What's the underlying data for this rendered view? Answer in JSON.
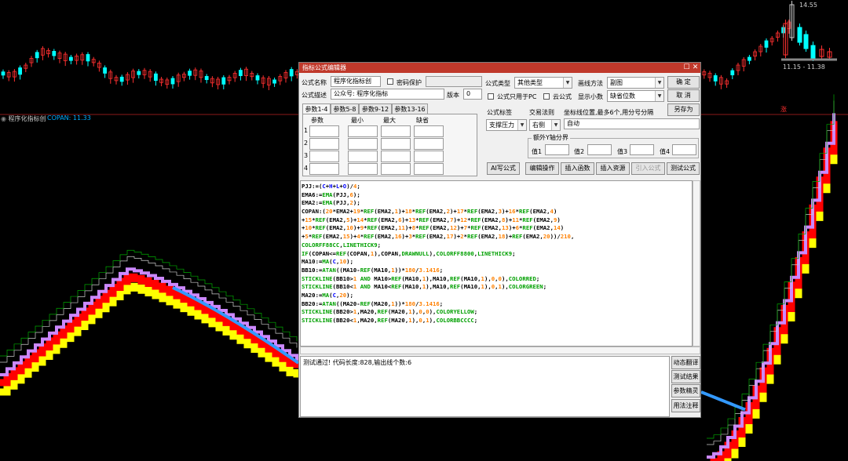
{
  "chart": {
    "indicator_name": "程序化指标创",
    "indicator_value": "COPAN: 11.33",
    "price_high": "14.55",
    "price_range": "11.15 - 11.38",
    "rise_badge": "涨",
    "colors": {
      "red": "#ff0000",
      "yellow": "#ffff00",
      "violet": "#cc88ff",
      "blue": "#3399ff",
      "green": "#00aa00",
      "white": "#cccccc",
      "cyan": "#00ffff"
    }
  },
  "dialog": {
    "title": "指标公式编辑器",
    "formula_name_label": "公式名称",
    "formula_name_value": "程序化指标创",
    "password_label": "密码保护",
    "formula_desc_label": "公式描述",
    "formula_desc_value": "公众号: 程序化指标",
    "version_label": "版本",
    "version_value": "0",
    "type_label": "公式类型",
    "type_value": "其他类型",
    "draw_label": "画线方法",
    "draw_value": "副图",
    "pc_label": "公式只用于PC",
    "cloud_label": "云公式",
    "decimals_label": "显示小数",
    "decimals_value": "缺省位数",
    "confirm": "确  定",
    "cancel": "取  消",
    "save_as": "另存为",
    "tabs": [
      "参数1-4",
      "参数5-8",
      "参数9-12",
      "参数13-16"
    ],
    "param_headers": [
      "参数",
      "最小",
      "最大",
      "缺省"
    ],
    "param_rows": [
      "1",
      "2",
      "3",
      "4"
    ],
    "tag_label": "公式标签",
    "rule_label": "交易法则",
    "coord_label": "坐标线位置,最多6个,用分号分隔",
    "tag_value": "支撑压力",
    "rule_value": "右侧",
    "coord_value": "自动",
    "extra_axis_label": "额外Y轴分界",
    "values": [
      "值1",
      "值2",
      "值3",
      "值4"
    ],
    "ai_btn": "AI写公式",
    "edit_btn": "编辑操作",
    "insert_fn_btn": "插入函数",
    "insert_res_btn": "插入资源",
    "import_btn": "引入公式",
    "test_btn": "测试公式",
    "status": "测试通过! 代码长度:828,输出线个数:6",
    "side_btns": [
      "动态翻译",
      "测试结果",
      "参数精灵",
      "用法注释"
    ]
  },
  "code_lines": [
    [
      [
        "d",
        "PJJ:=("
      ],
      [
        "k",
        "C"
      ],
      [
        "d",
        "+"
      ],
      [
        "k",
        "H"
      ],
      [
        "d",
        "+"
      ],
      [
        "k",
        "L"
      ],
      [
        "d",
        "+"
      ],
      [
        "k",
        "O"
      ],
      [
        "d",
        ")/"
      ],
      [
        "n",
        "4"
      ],
      [
        "d",
        ";"
      ]
    ],
    [
      [
        "d",
        "EMA6:="
      ],
      [
        "f",
        "EMA"
      ],
      [
        "d",
        "(PJJ,"
      ],
      [
        "n",
        "6"
      ],
      [
        "d",
        ");"
      ]
    ],
    [
      [
        "d",
        "EMA2:="
      ],
      [
        "f",
        "EMA"
      ],
      [
        "d",
        "(PJJ,"
      ],
      [
        "n",
        "2"
      ],
      [
        "d",
        ");"
      ]
    ],
    [
      [
        "d",
        "COPAN:("
      ],
      [
        "n",
        "20"
      ],
      [
        "d",
        "*EMA2+"
      ],
      [
        "n",
        "19"
      ],
      [
        "d",
        "*"
      ],
      [
        "f",
        "REF"
      ],
      [
        "d",
        "(EMA2,"
      ],
      [
        "n",
        "1"
      ],
      [
        "d",
        ")+"
      ],
      [
        "n",
        "18"
      ],
      [
        "d",
        "*"
      ],
      [
        "f",
        "REF"
      ],
      [
        "d",
        "(EMA2,"
      ],
      [
        "n",
        "2"
      ],
      [
        "d",
        ")+"
      ],
      [
        "n",
        "17"
      ],
      [
        "d",
        "*"
      ],
      [
        "f",
        "REF"
      ],
      [
        "d",
        "(EMA2,"
      ],
      [
        "n",
        "3"
      ],
      [
        "d",
        ")+"
      ],
      [
        "n",
        "16"
      ],
      [
        "d",
        "*"
      ],
      [
        "f",
        "REF"
      ],
      [
        "d",
        "(EMA2,"
      ],
      [
        "n",
        "4"
      ],
      [
        "d",
        ")"
      ]
    ],
    [
      [
        "d",
        "+"
      ],
      [
        "n",
        "15"
      ],
      [
        "d",
        "*"
      ],
      [
        "f",
        "REF"
      ],
      [
        "d",
        "(EMA2,"
      ],
      [
        "n",
        "5"
      ],
      [
        "d",
        ")+"
      ],
      [
        "n",
        "14"
      ],
      [
        "d",
        "*"
      ],
      [
        "f",
        "REF"
      ],
      [
        "d",
        "(EMA2,"
      ],
      [
        "n",
        "6"
      ],
      [
        "d",
        ")+"
      ],
      [
        "n",
        "13"
      ],
      [
        "d",
        "*"
      ],
      [
        "f",
        "REF"
      ],
      [
        "d",
        "(EMA2,"
      ],
      [
        "n",
        "7"
      ],
      [
        "d",
        ")+"
      ],
      [
        "n",
        "12"
      ],
      [
        "d",
        "*"
      ],
      [
        "f",
        "REF"
      ],
      [
        "d",
        "(EMA2,"
      ],
      [
        "n",
        "8"
      ],
      [
        "d",
        ")+"
      ],
      [
        "n",
        "11"
      ],
      [
        "d",
        "*"
      ],
      [
        "f",
        "REF"
      ],
      [
        "d",
        "(EMA2,"
      ],
      [
        "n",
        "9"
      ],
      [
        "d",
        ")"
      ]
    ],
    [
      [
        "d",
        "+"
      ],
      [
        "n",
        "10"
      ],
      [
        "d",
        "*"
      ],
      [
        "f",
        "REF"
      ],
      [
        "d",
        "(EMA2,"
      ],
      [
        "n",
        "10"
      ],
      [
        "d",
        ")+"
      ],
      [
        "n",
        "9"
      ],
      [
        "d",
        "*"
      ],
      [
        "f",
        "REF"
      ],
      [
        "d",
        "(EMA2,"
      ],
      [
        "n",
        "11"
      ],
      [
        "d",
        ")+"
      ],
      [
        "n",
        "8"
      ],
      [
        "d",
        "*"
      ],
      [
        "f",
        "REF"
      ],
      [
        "d",
        "(EMA2,"
      ],
      [
        "n",
        "12"
      ],
      [
        "d",
        ")+"
      ],
      [
        "n",
        "7"
      ],
      [
        "d",
        "*"
      ],
      [
        "f",
        "REF"
      ],
      [
        "d",
        "(EMA2,"
      ],
      [
        "n",
        "13"
      ],
      [
        "d",
        ")+"
      ],
      [
        "n",
        "6"
      ],
      [
        "d",
        "*"
      ],
      [
        "f",
        "REF"
      ],
      [
        "d",
        "(EMA2,"
      ],
      [
        "n",
        "14"
      ],
      [
        "d",
        ")"
      ]
    ],
    [
      [
        "d",
        "+"
      ],
      [
        "n",
        "5"
      ],
      [
        "d",
        "*"
      ],
      [
        "f",
        "REF"
      ],
      [
        "d",
        "(EMA2,"
      ],
      [
        "n",
        "15"
      ],
      [
        "d",
        ")+"
      ],
      [
        "n",
        "4"
      ],
      [
        "d",
        "*"
      ],
      [
        "f",
        "REF"
      ],
      [
        "d",
        "(EMA2,"
      ],
      [
        "n",
        "16"
      ],
      [
        "d",
        ")+"
      ],
      [
        "n",
        "3"
      ],
      [
        "d",
        "*"
      ],
      [
        "f",
        "REF"
      ],
      [
        "d",
        "(EMA2,"
      ],
      [
        "n",
        "17"
      ],
      [
        "d",
        ")+"
      ],
      [
        "n",
        "2"
      ],
      [
        "d",
        "*"
      ],
      [
        "f",
        "REF"
      ],
      [
        "d",
        "(EMA2,"
      ],
      [
        "n",
        "18"
      ],
      [
        "d",
        ")+"
      ],
      [
        "f",
        "REF"
      ],
      [
        "d",
        "(EMA2,"
      ],
      [
        "n",
        "20"
      ],
      [
        "d",
        "))/"
      ],
      [
        "n",
        "210"
      ],
      [
        "d",
        ","
      ]
    ],
    [
      [
        "f",
        "COLORFF88CC"
      ],
      [
        "d",
        ","
      ],
      [
        "f",
        "LINETHICK9"
      ],
      [
        "d",
        ";"
      ]
    ],
    [
      [
        "f",
        "IF"
      ],
      [
        "d",
        "(COPAN<="
      ],
      [
        "f",
        "REF"
      ],
      [
        "d",
        "(COPAN,"
      ],
      [
        "n",
        "1"
      ],
      [
        "d",
        "),COPAN,"
      ],
      [
        "f",
        "DRAWNULL"
      ],
      [
        "d",
        "),"
      ],
      [
        "f",
        "COLORFF8800"
      ],
      [
        "d",
        ","
      ],
      [
        "f",
        "LINETHICK9"
      ],
      [
        "d",
        ";"
      ]
    ],
    [
      [
        "d",
        "MA10:="
      ],
      [
        "f",
        "MA"
      ],
      [
        "d",
        "("
      ],
      [
        "k",
        "C"
      ],
      [
        "d",
        ","
      ],
      [
        "n",
        "10"
      ],
      [
        "d",
        ");"
      ]
    ],
    [
      [
        "d",
        "BB10:="
      ],
      [
        "f",
        "ATAN"
      ],
      [
        "d",
        "((MA10-"
      ],
      [
        "f",
        "REF"
      ],
      [
        "d",
        "(MA10,"
      ],
      [
        "n",
        "1"
      ],
      [
        "d",
        "))*"
      ],
      [
        "n",
        "180"
      ],
      [
        "d",
        "/"
      ],
      [
        "n",
        "3.1416"
      ],
      [
        "d",
        ";"
      ]
    ],
    [
      [
        "f",
        "STICKLINE"
      ],
      [
        "d",
        "(BB10>"
      ],
      [
        "n",
        "1"
      ],
      [
        "d",
        " "
      ],
      [
        "f",
        "AND"
      ],
      [
        "d",
        " MA10>"
      ],
      [
        "f",
        "REF"
      ],
      [
        "d",
        "(MA10,"
      ],
      [
        "n",
        "1"
      ],
      [
        "d",
        "),MA10,"
      ],
      [
        "f",
        "REF"
      ],
      [
        "d",
        "(MA10,"
      ],
      [
        "n",
        "1"
      ],
      [
        "d",
        "),"
      ],
      [
        "n",
        "0"
      ],
      [
        "d",
        ","
      ],
      [
        "n",
        "0"
      ],
      [
        "d",
        "),"
      ],
      [
        "f",
        "COLORRED"
      ],
      [
        "d",
        ";"
      ]
    ],
    [
      [
        "f",
        "STICKLINE"
      ],
      [
        "d",
        "(BB10<"
      ],
      [
        "n",
        "1"
      ],
      [
        "d",
        " "
      ],
      [
        "f",
        "AND"
      ],
      [
        "d",
        " MA10<"
      ],
      [
        "f",
        "REF"
      ],
      [
        "d",
        "(MA10,"
      ],
      [
        "n",
        "1"
      ],
      [
        "d",
        "),MA10,"
      ],
      [
        "f",
        "REF"
      ],
      [
        "d",
        "(MA10,"
      ],
      [
        "n",
        "1"
      ],
      [
        "d",
        "),"
      ],
      [
        "n",
        "0"
      ],
      [
        "d",
        ","
      ],
      [
        "n",
        "1"
      ],
      [
        "d",
        "),"
      ],
      [
        "f",
        "COLORGREEN"
      ],
      [
        "d",
        ";"
      ]
    ],
    [
      [
        "d",
        "MA20:="
      ],
      [
        "f",
        "MA"
      ],
      [
        "d",
        "("
      ],
      [
        "k",
        "C"
      ],
      [
        "d",
        ","
      ],
      [
        "n",
        "20"
      ],
      [
        "d",
        ");"
      ]
    ],
    [
      [
        "d",
        "BB20:="
      ],
      [
        "f",
        "ATAN"
      ],
      [
        "d",
        "((MA20-"
      ],
      [
        "f",
        "REF"
      ],
      [
        "d",
        "(MA20,"
      ],
      [
        "n",
        "1"
      ],
      [
        "d",
        "))*"
      ],
      [
        "n",
        "180"
      ],
      [
        "d",
        "/"
      ],
      [
        "n",
        "3.1416"
      ],
      [
        "d",
        ";"
      ]
    ],
    [
      [
        "f",
        "STICKLINE"
      ],
      [
        "d",
        "(BB20>"
      ],
      [
        "n",
        "1"
      ],
      [
        "d",
        ",MA20,"
      ],
      [
        "f",
        "REF"
      ],
      [
        "d",
        "(MA20,"
      ],
      [
        "n",
        "1"
      ],
      [
        "d",
        "),"
      ],
      [
        "n",
        "0"
      ],
      [
        "d",
        ","
      ],
      [
        "n",
        "0"
      ],
      [
        "d",
        "),"
      ],
      [
        "f",
        "COLORYELLOW"
      ],
      [
        "d",
        ";"
      ]
    ],
    [
      [
        "f",
        "STICKLINE"
      ],
      [
        "d",
        "(BB20<"
      ],
      [
        "n",
        "1"
      ],
      [
        "d",
        ",MA20,"
      ],
      [
        "f",
        "REF"
      ],
      [
        "d",
        "(MA20,"
      ],
      [
        "n",
        "1"
      ],
      [
        "d",
        "),"
      ],
      [
        "n",
        "0"
      ],
      [
        "d",
        ","
      ],
      [
        "n",
        "1"
      ],
      [
        "d",
        "),"
      ],
      [
        "f",
        "COLORBBCCCC"
      ],
      [
        "d",
        ";"
      ]
    ]
  ]
}
